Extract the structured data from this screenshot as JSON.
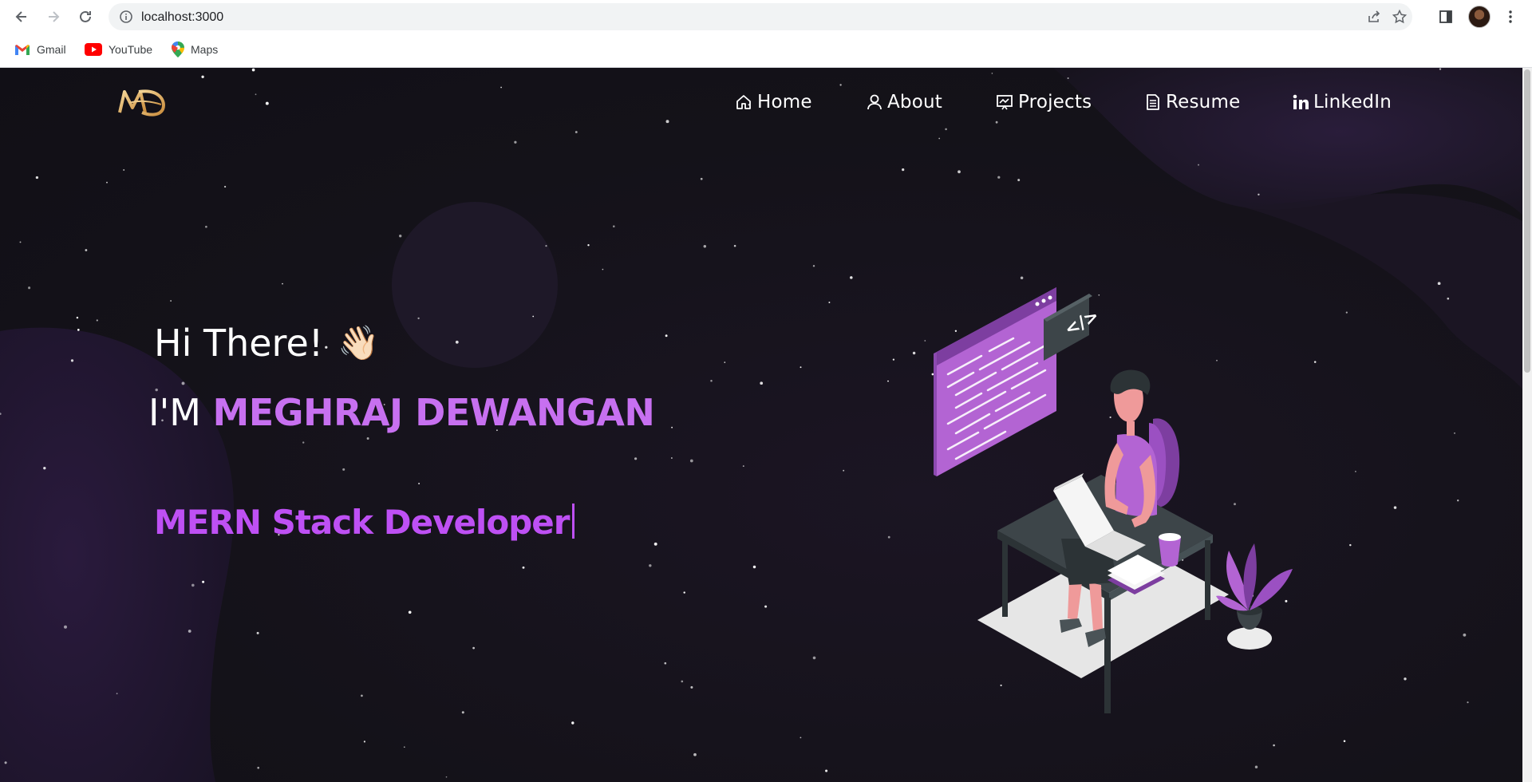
{
  "browser": {
    "url": "localhost:3000",
    "bookmarks": [
      {
        "label": "Gmail",
        "icon": "gmail-icon"
      },
      {
        "label": "YouTube",
        "icon": "youtube-icon"
      },
      {
        "label": "Maps",
        "icon": "maps-icon"
      }
    ]
  },
  "site": {
    "logo_text": "MD",
    "nav": [
      {
        "label": "Home",
        "icon": "home-icon"
      },
      {
        "label": "About",
        "icon": "user-icon"
      },
      {
        "label": "Projects",
        "icon": "projects-icon"
      },
      {
        "label": "Resume",
        "icon": "document-icon"
      },
      {
        "label": "LinkedIn",
        "icon": "linkedin-icon"
      }
    ],
    "hero": {
      "greeting": "Hi There!",
      "wave_emoji": "👋🏻",
      "name_prefix": "I'M",
      "name": "MEGHRAJ DEWANGAN",
      "role": "MERN Stack Developer"
    },
    "illustration_code_label": "</>"
  },
  "colors": {
    "accent": "#c770f0",
    "role_accent": "#be50f4",
    "background": "#141219"
  }
}
